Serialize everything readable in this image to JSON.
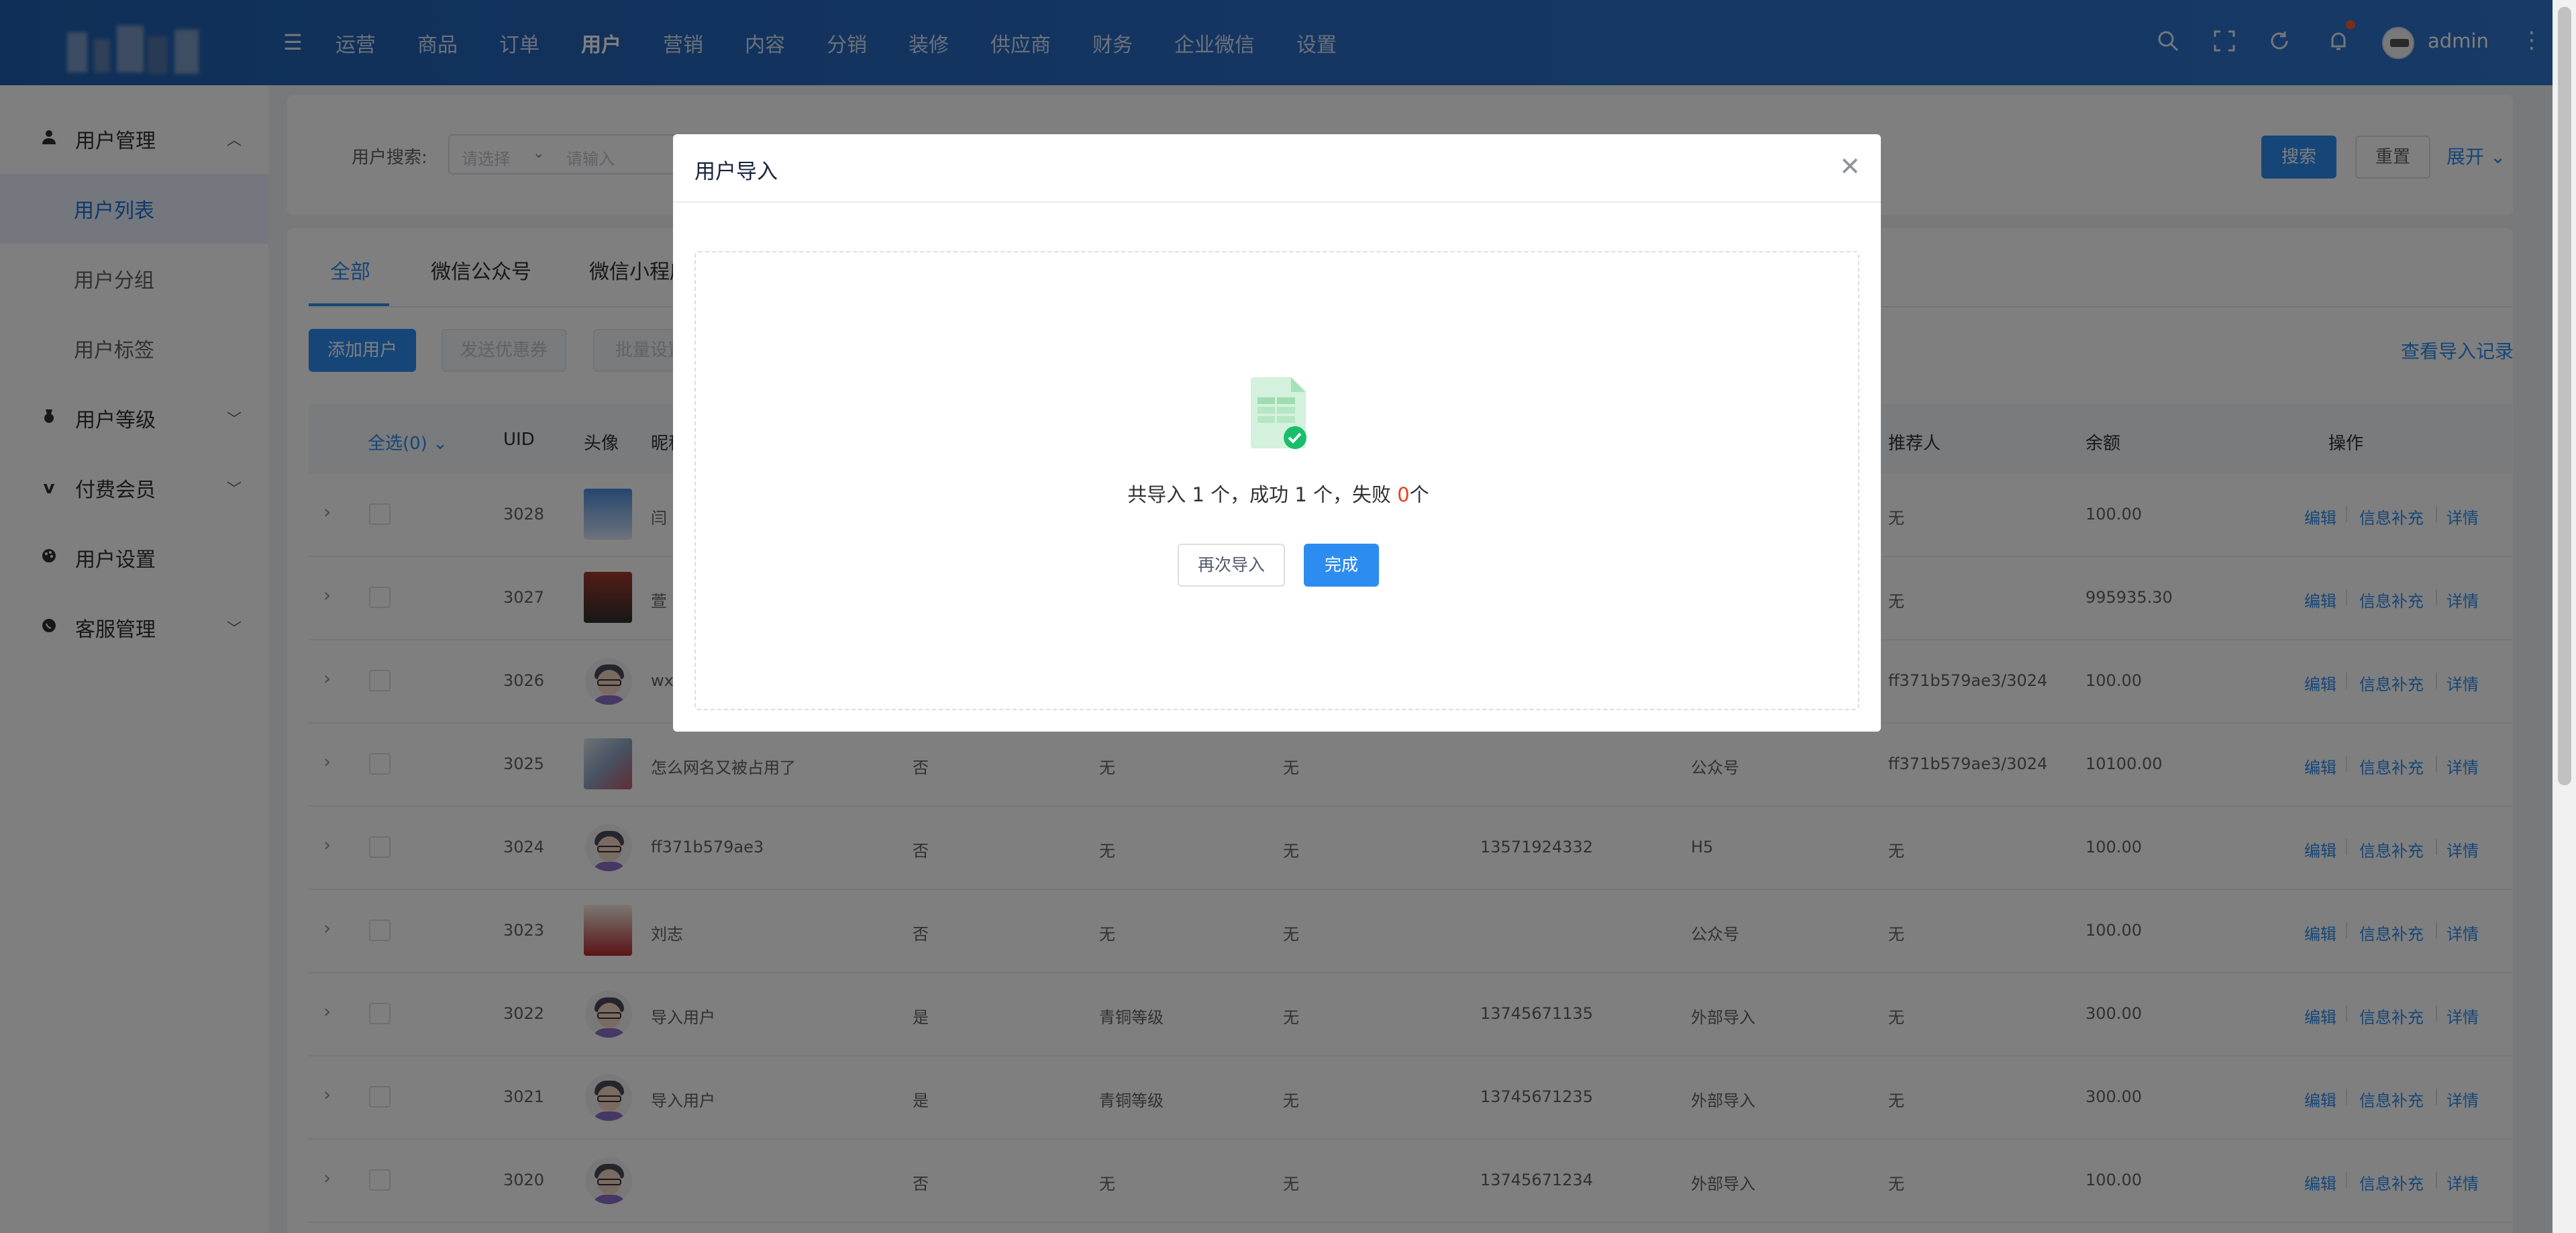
{
  "header": {
    "nav": [
      "运营",
      "商品",
      "订单",
      "用户",
      "营销",
      "内容",
      "分销",
      "装修",
      "供应商",
      "财务",
      "企业微信",
      "设置"
    ],
    "active_nav": "用户",
    "user_name": "admin"
  },
  "sidebar": {
    "user_management": "用户管理",
    "user_list": "用户列表",
    "user_group": "用户分组",
    "user_tag": "用户标签",
    "user_level": "用户等级",
    "paid_member": "付费会员",
    "user_settings": "用户设置",
    "customer_service": "客服管理"
  },
  "search": {
    "label": "用户搜索:",
    "select_placeholder": "请选择",
    "input_placeholder": "请输入",
    "search_btn": "搜索",
    "reset_btn": "重置",
    "expand_btn": "展开"
  },
  "tabs": [
    "全部",
    "微信公众号",
    "微信小程序"
  ],
  "toolbar": {
    "add_user": "添加用户",
    "send_coupon": "发送优惠券",
    "batch_set": "批量设置",
    "view_records": "查看导入记录"
  },
  "table": {
    "headers": {
      "select_all": "全选(0)",
      "uid": "UID",
      "avatar": "头像",
      "nickname": "昵称",
      "referrer": "推荐人",
      "balance": "余额",
      "actions": "操作"
    },
    "action_labels": {
      "edit": "编辑",
      "info": "信息补充",
      "detail": "详情"
    },
    "rows": [
      {
        "uid": "3028",
        "nickname": "闫",
        "c1": "",
        "c2": "",
        "c3": "",
        "phone": "",
        "source": "",
        "referrer": "无",
        "balance": "100.00",
        "avatar": "photo1"
      },
      {
        "uid": "3027",
        "nickname": "萱",
        "c1": "",
        "c2": "",
        "c3": "",
        "phone": "",
        "source": "",
        "referrer": "无",
        "balance": "995935.30",
        "avatar": "photo2"
      },
      {
        "uid": "3026",
        "nickname": "wx",
        "c1": "",
        "c2": "",
        "c3": "",
        "phone": "",
        "source": "",
        "referrer": "ff371b579ae3/3024",
        "balance": "100.00",
        "avatar": "round"
      },
      {
        "uid": "3025",
        "nickname": "怎么网名又被占用了",
        "c1": "否",
        "c2": "无",
        "c3": "无",
        "phone": "",
        "source": "公众号",
        "referrer": "ff371b579ae3/3024",
        "balance": "10100.00",
        "avatar": "photo3"
      },
      {
        "uid": "3024",
        "nickname": "ff371b579ae3",
        "c1": "否",
        "c2": "无",
        "c3": "无",
        "phone": "13571924332",
        "source": "H5",
        "referrer": "无",
        "balance": "100.00",
        "avatar": "round"
      },
      {
        "uid": "3023",
        "nickname": "刘志",
        "c1": "否",
        "c2": "无",
        "c3": "无",
        "phone": "",
        "source": "公众号",
        "referrer": "无",
        "balance": "100.00",
        "avatar": "photo4"
      },
      {
        "uid": "3022",
        "nickname": "导入用户",
        "c1": "是",
        "c2": "青铜等级",
        "c3": "无",
        "phone": "13745671135",
        "source": "外部导入",
        "referrer": "无",
        "balance": "300.00",
        "avatar": "round"
      },
      {
        "uid": "3021",
        "nickname": "导入用户",
        "c1": "是",
        "c2": "青铜等级",
        "c3": "无",
        "phone": "13745671235",
        "source": "外部导入",
        "referrer": "无",
        "balance": "300.00",
        "avatar": "round"
      },
      {
        "uid": "3020",
        "nickname": "",
        "c1": "否",
        "c2": "无",
        "c3": "无",
        "phone": "13745671234",
        "source": "外部导入",
        "referrer": "无",
        "balance": "100.00",
        "avatar": "round"
      }
    ]
  },
  "dialog": {
    "title": "用户导入",
    "result_prefix": "共导入 1 个，成功 1 个，失败 ",
    "fail_count": "0",
    "result_suffix": "个",
    "again_btn": "再次导入",
    "done_btn": "完成"
  }
}
